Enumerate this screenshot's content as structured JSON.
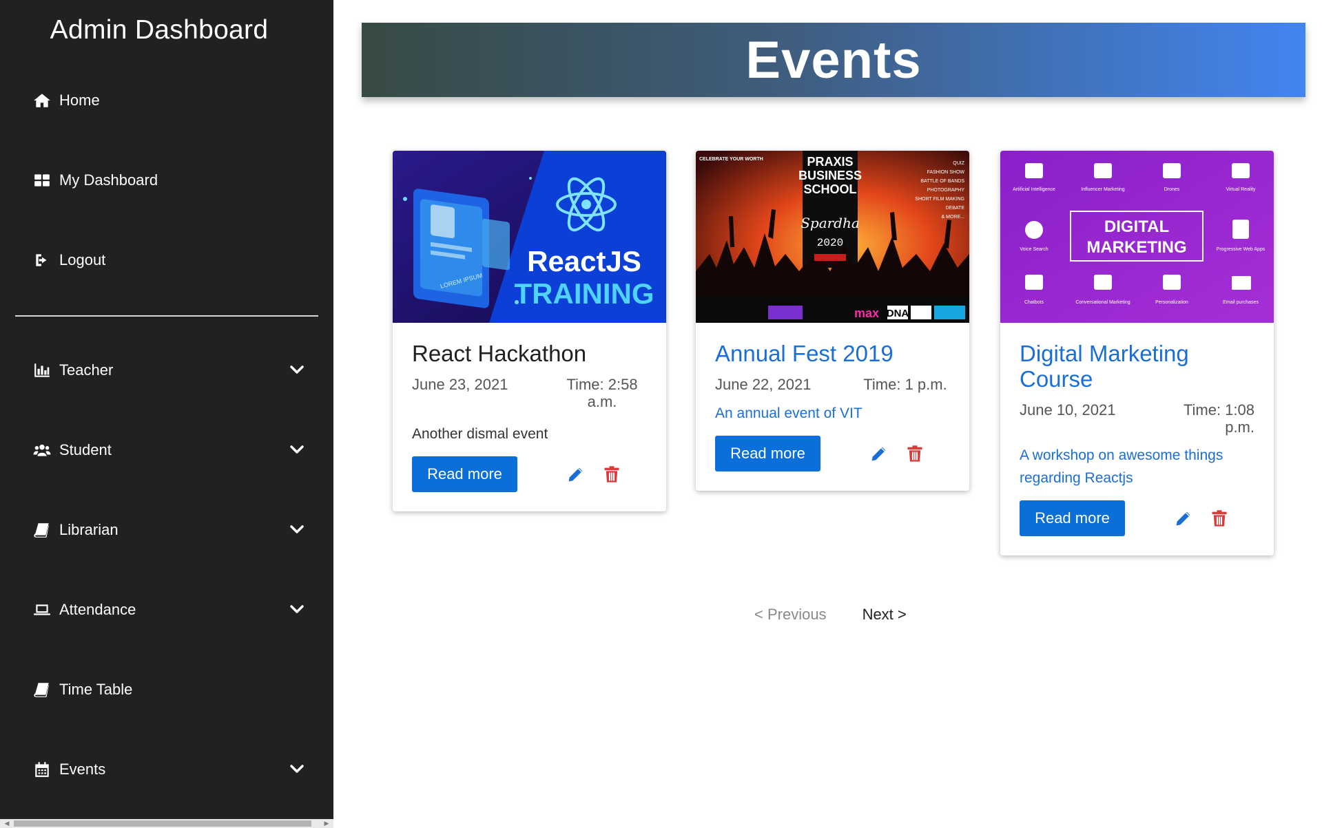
{
  "sidebar": {
    "brand": "Admin Dashboard",
    "top_items": [
      {
        "label": "Home",
        "icon": "home-icon"
      },
      {
        "label": "My Dashboard",
        "icon": "dashboard-grid-icon"
      },
      {
        "label": "Logout",
        "icon": "logout-icon"
      }
    ],
    "sections": [
      {
        "label": "Teacher",
        "icon": "bar-chart-icon"
      },
      {
        "label": "Student",
        "icon": "users-icon"
      },
      {
        "label": "Librarian",
        "icon": "book-icon"
      },
      {
        "label": "Attendance",
        "icon": "laptop-icon"
      },
      {
        "label": "Time Table",
        "icon": "book-icon"
      },
      {
        "label": "Events",
        "icon": "calendar-icon"
      }
    ]
  },
  "header": {
    "title": "Events"
  },
  "cards": [
    {
      "title": "React Hackathon",
      "date": "June 23, 2021",
      "time": "Time: 2:58 a.m.",
      "description": "Another dismal event",
      "button": "Read more",
      "image_text": [
        "ReactJS",
        "TRAINING",
        "LOREM IPSUM"
      ]
    },
    {
      "title": "Annual Fest 2019",
      "date": "June 22, 2021",
      "time": "Time: 1 p.m.",
      "description": "An annual event of VIT",
      "button": "Read more",
      "image_text": [
        "PRAXIS",
        "BUSINESS",
        "SCHOOL",
        "CELEBRATE YOUR WORTH",
        "Spardha",
        "2020",
        "max",
        "DNA",
        "QUIZ",
        "FASHION SHOW",
        "BATTLE OF BANDS",
        "PHOTOGRAPHY",
        "SHORT FILM MAKING",
        "DEBATE",
        "& MORE..."
      ]
    },
    {
      "title": "Digital Marketing Course",
      "date": "June 10, 2021",
      "time": "Time: 1:08 p.m.",
      "description": "A workshop on awesome things regarding Reactjs",
      "button": "Read more",
      "image_text": [
        "DIGITAL",
        "MARKETING",
        "Artificial Intelligence",
        "Influencer Marketing",
        "Drones",
        "Virtual Reality",
        "Voice Search",
        "Progressive Web Apps",
        "Chatbots",
        "Conversational Marketing",
        "Personalization",
        "Email purchases"
      ]
    }
  ],
  "pagination": {
    "previous": "< Previous",
    "next": "Next >"
  },
  "colors": {
    "sidebar_bg": "#212121",
    "accent": "#0a6fd8",
    "link": "#1a6fd6",
    "delete": "#d93a3a"
  }
}
